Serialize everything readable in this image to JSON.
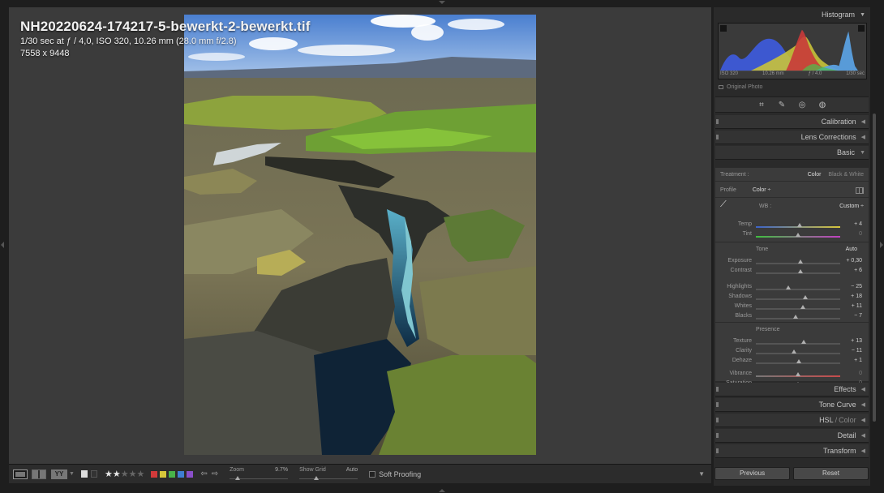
{
  "info": {
    "filename": "NH20220624-174217-5-bewerkt-2-bewerkt.tif",
    "exposure": "1/30 sec at ƒ / 4,0, ISO 320, 10.26 mm (28.0 mm f/2.8)",
    "dimensions": "7558 x 9448"
  },
  "toolbar": {
    "rating_stars": 2,
    "rating_max": 5,
    "color_labels": [
      "#d23a3a",
      "#d6c73a",
      "#49b34a",
      "#3f7fd3",
      "#8a4fc9"
    ],
    "zoom_label": "Zoom",
    "zoom_value": "9.7%",
    "zoom_level": 0.1,
    "show_grid_label": "Show Grid",
    "show_grid_value": "Auto",
    "soft_proofing": "Soft Proofing"
  },
  "histogram": {
    "title": "Histogram",
    "iso": "ISO 320",
    "focal": "10.26 mm",
    "aperture": "ƒ / 4.0",
    "shutter": "1/30 sec",
    "original_photo": "Original Photo"
  },
  "sections": {
    "calibration": "Calibration",
    "lens": "Lens Corrections",
    "basic": "Basic",
    "effects": "Effects",
    "tone_curve": "Tone Curve",
    "hsl": "HSL",
    "hsl_sep": "/",
    "color": "Color",
    "detail": "Detail",
    "transform": "Transform"
  },
  "basic": {
    "treatment_label": "Treatment :",
    "treatment_color": "Color",
    "treatment_bw": "Black & White",
    "profile_label": "Profile",
    "profile_value": "Color ÷",
    "wb_label": "WB :",
    "wb_value": "Custom ÷",
    "tone_label": "Tone",
    "tone_auto": "Auto",
    "presence_label": "Presence",
    "sliders": [
      {
        "name": "Temp",
        "value": "+ 4",
        "pos": 0.52
      },
      {
        "name": "Tint",
        "value": "0",
        "pos": 0.5
      },
      {
        "name": "Exposure",
        "value": "+ 0,30",
        "pos": 0.53
      },
      {
        "name": "Contrast",
        "value": "+ 6",
        "pos": 0.53
      },
      {
        "name": "Highlights",
        "value": "− 25",
        "pos": 0.38
      },
      {
        "name": "Shadows",
        "value": "+ 18",
        "pos": 0.59
      },
      {
        "name": "Whites",
        "value": "+ 11",
        "pos": 0.56
      },
      {
        "name": "Blacks",
        "value": "− 7",
        "pos": 0.47
      },
      {
        "name": "Texture",
        "value": "+ 13",
        "pos": 0.57
      },
      {
        "name": "Clarity",
        "value": "− 11",
        "pos": 0.45
      },
      {
        "name": "Dehaze",
        "value": "+ 1",
        "pos": 0.51
      },
      {
        "name": "Vibrance",
        "value": "0",
        "pos": 0.5
      },
      {
        "name": "Saturation",
        "value": "0",
        "pos": 0.5
      }
    ]
  },
  "buttons": {
    "previous": "Previous",
    "reset": "Reset"
  }
}
